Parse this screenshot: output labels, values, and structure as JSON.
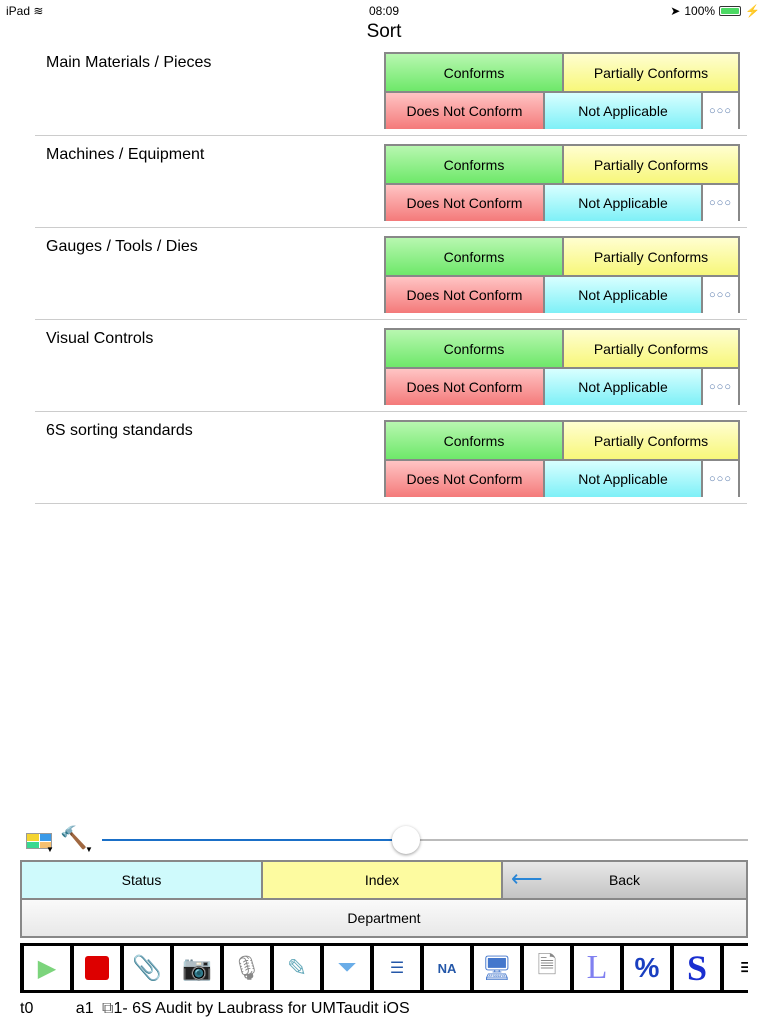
{
  "status_bar": {
    "device": "iPad",
    "time": "08:09",
    "battery": "100%"
  },
  "title": "Sort",
  "rows": [
    {
      "label": "Main Materials / Pieces"
    },
    {
      "label": "Machines / Equipment"
    },
    {
      "label": "Gauges / Tools / Dies"
    },
    {
      "label": "Visual Controls"
    },
    {
      "label": "6S sorting standards"
    }
  ],
  "options": {
    "conforms": "Conforms",
    "partial": "Partially Conforms",
    "not_conform": "Does Not Conform",
    "na": "Not Applicable",
    "more": "○○○"
  },
  "slider": {
    "value": 0.47
  },
  "nav": {
    "status": "Status",
    "index": "Index",
    "back": "Back",
    "department": "Department"
  },
  "toolbar": {
    "icons": [
      "play-icon",
      "stop-icon",
      "paperclip-icon",
      "camera-icon",
      "microphone-icon",
      "signature-icon",
      "filter-icon",
      "checklist-icon",
      "checklist-na-icon",
      "sync-icon",
      "document-info-icon",
      "l-icon",
      "percent-icon",
      "s-icon",
      "menu-icon"
    ],
    "na_label": "NA",
    "l_label": "L",
    "percent_label": "%",
    "s_label": "S"
  },
  "footer": {
    "t": "t0",
    "a": "a1",
    "audit": "1- 6S Audit by Laubrass for UMTaudit iOS"
  }
}
